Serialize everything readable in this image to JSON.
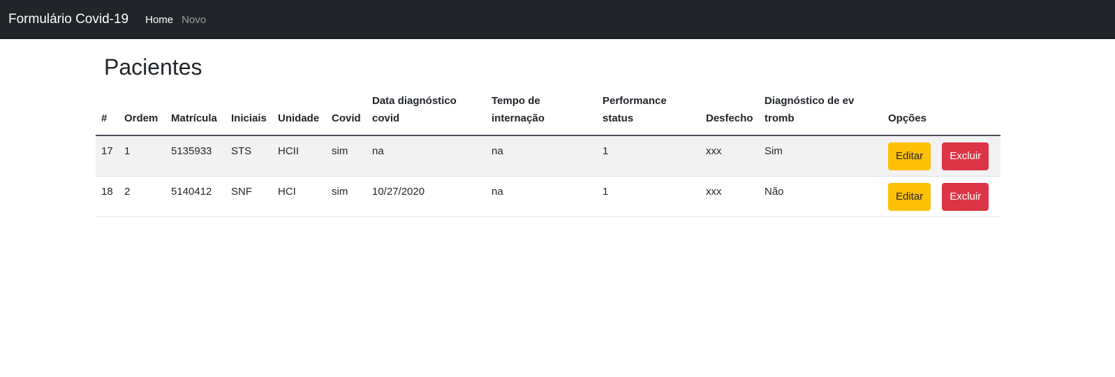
{
  "navbar": {
    "brand": "Formulário Covid-19",
    "links": [
      {
        "label": "Home",
        "active": true
      },
      {
        "label": "Novo",
        "active": false
      }
    ]
  },
  "page": {
    "title": "Pacientes"
  },
  "table": {
    "headers": [
      "#",
      "Ordem",
      "Matrícula",
      "Iniciais",
      "Unidade",
      "Covid",
      "Data diagnóstico covid",
      "Tempo de internação",
      "Performance status",
      "Desfecho",
      "Diagnóstico de ev tromb",
      "Opções"
    ],
    "rows": [
      {
        "cells": [
          "17",
          "1",
          "5135933",
          "STS",
          "HCII",
          "sim",
          "na",
          "na",
          "1",
          "xxx",
          "Sim"
        ],
        "edit_label": "Editar",
        "delete_label": "Excluir"
      },
      {
        "cells": [
          "18",
          "2",
          "5140412",
          "SNF",
          "HCI",
          "sim",
          "10/27/2020",
          "na",
          "1",
          "xxx",
          "Não"
        ],
        "edit_label": "Editar",
        "delete_label": "Excluir"
      }
    ]
  },
  "colors": {
    "navbar_bg": "#212529",
    "edit_button": "#ffc107",
    "delete_button": "#dc3545",
    "stripe": "#f2f2f2"
  }
}
